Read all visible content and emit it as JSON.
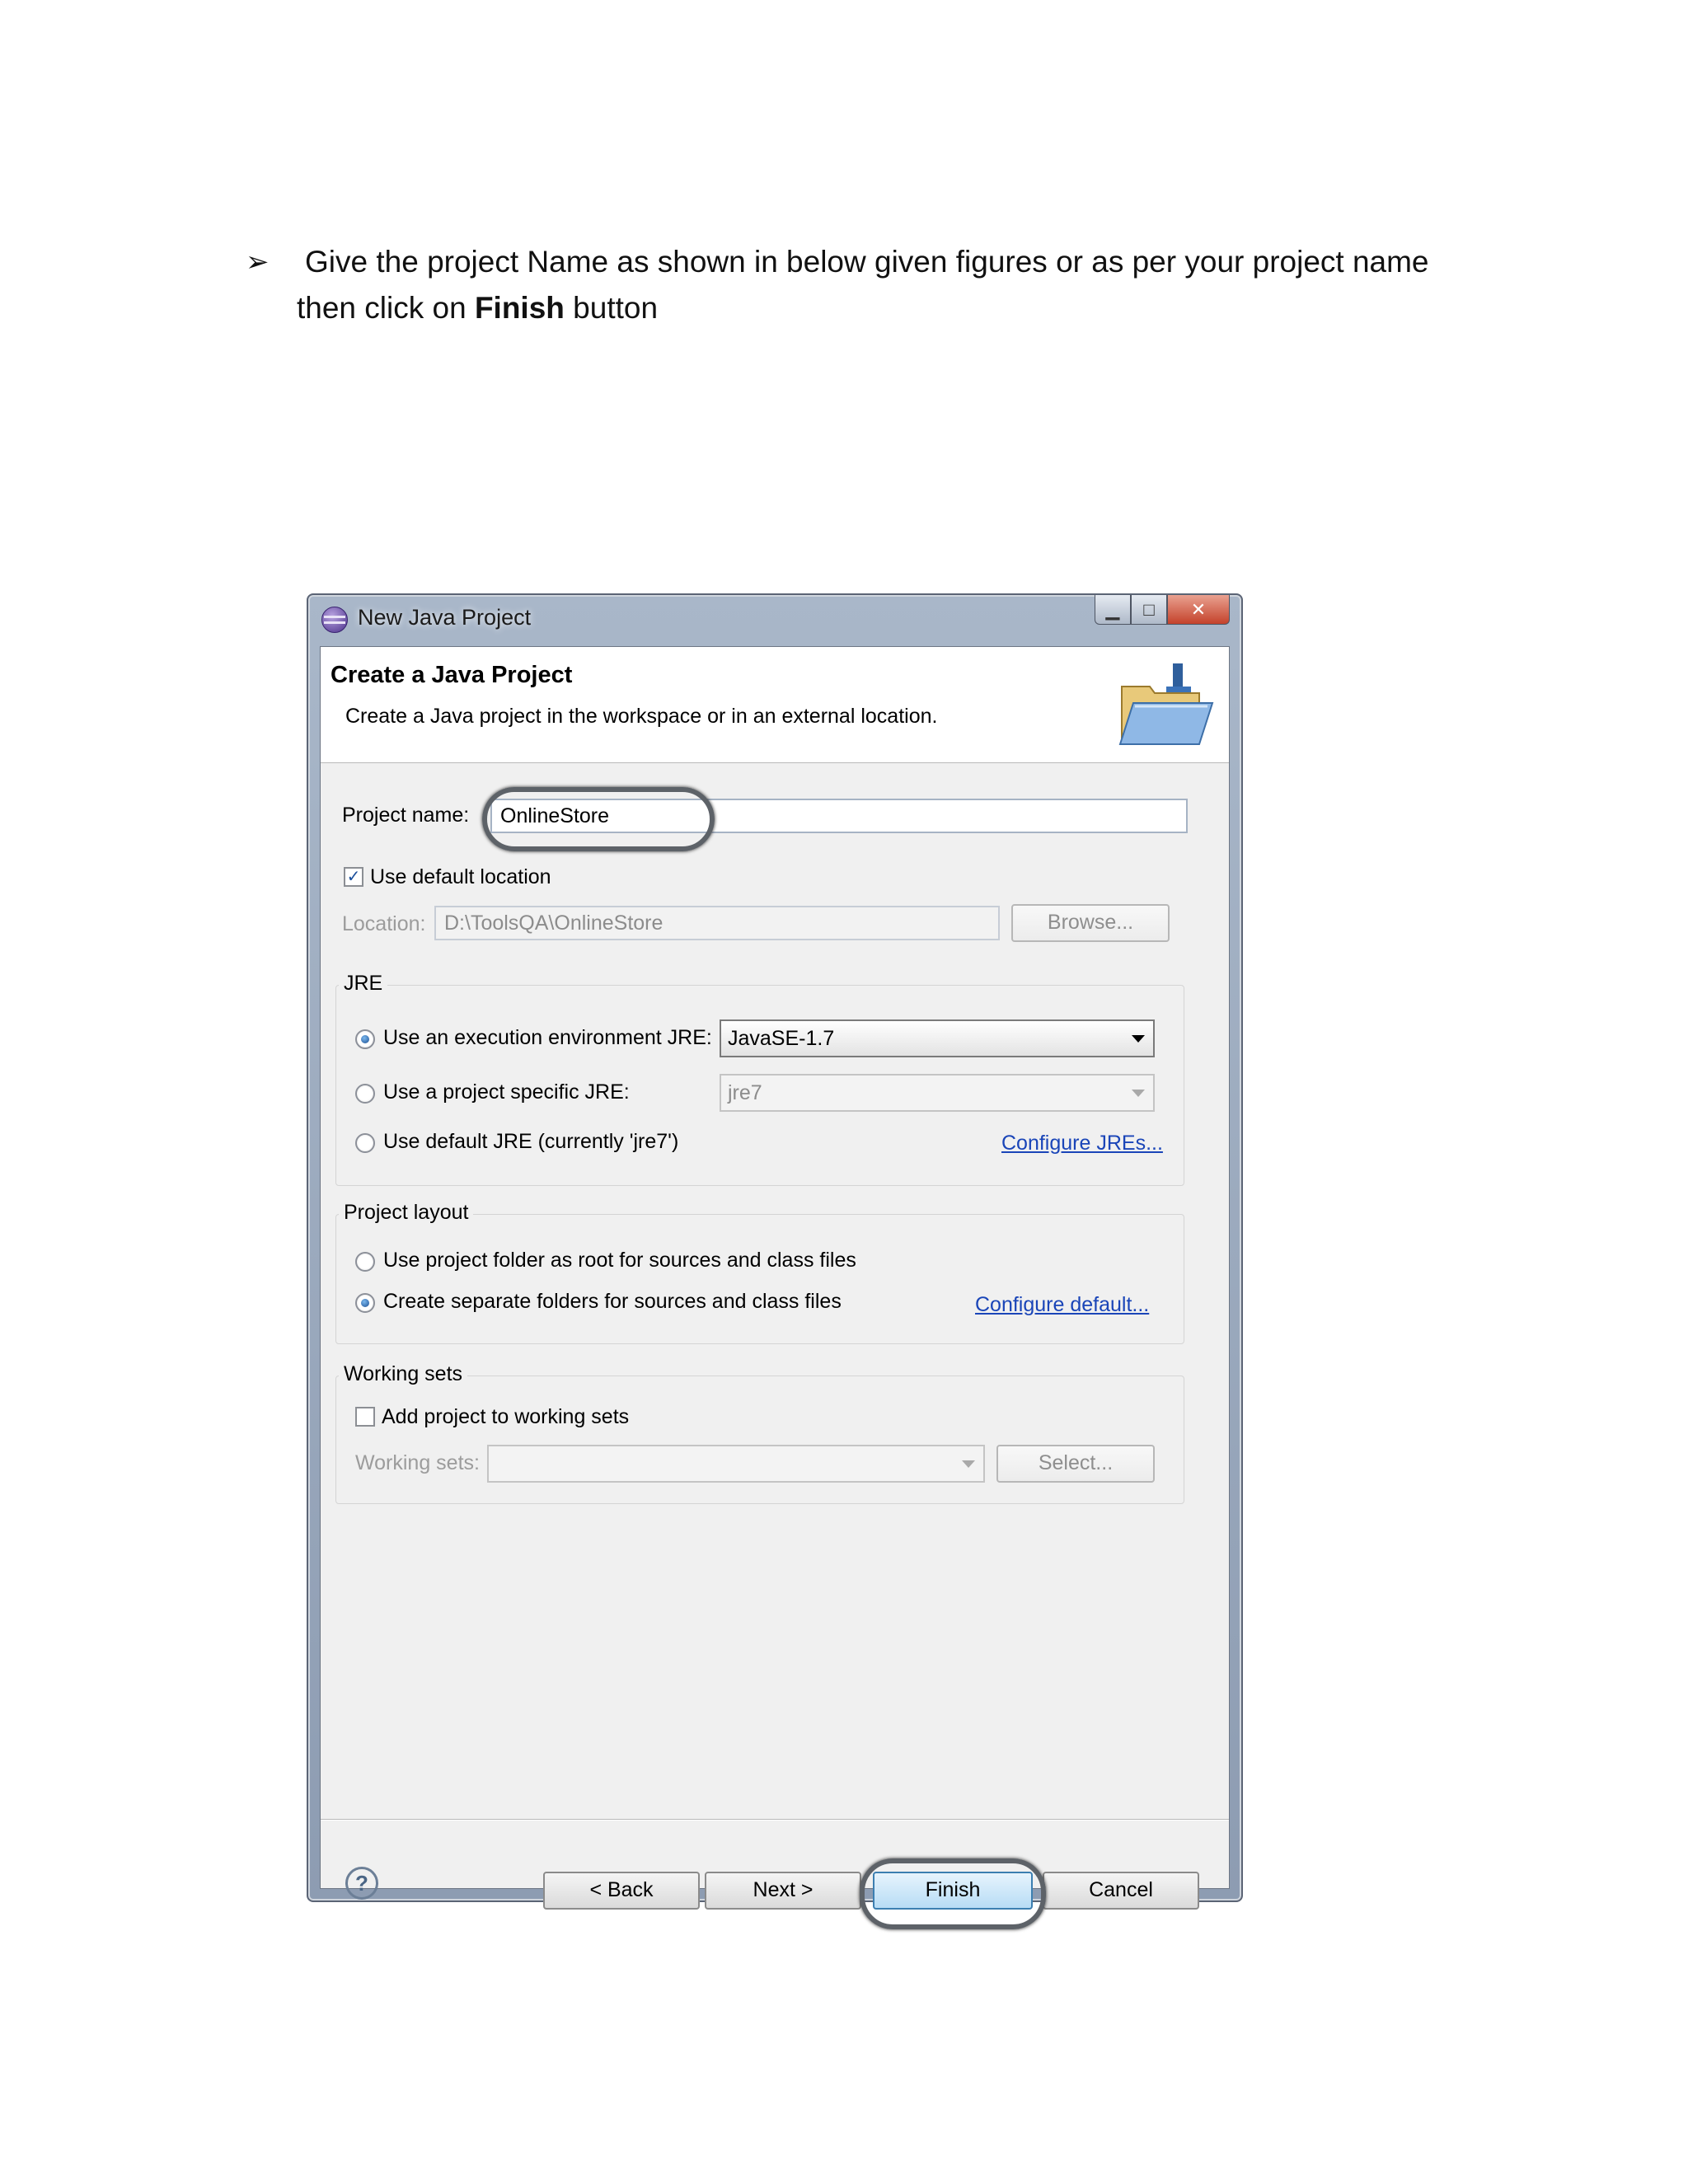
{
  "document": {
    "bullet": "➢",
    "line1": "Give the project Name as shown in below given figures or as per your project name",
    "line2_prefix": "then click on ",
    "line2_bold": "Finish",
    "line2_suffix": " button"
  },
  "dialog": {
    "window_title": "New Java Project",
    "header_title": "Create a Java Project",
    "header_description": "Create a Java project in the workspace or in an external location.",
    "project_name_label": "Project name:",
    "project_name_value": "OnlineStore",
    "use_default_location_label": "Use default location",
    "use_default_location_checked": true,
    "location_label": "Location:",
    "location_value": "D:\\ToolsQA\\OnlineStore",
    "browse_label": "Browse...",
    "jre": {
      "group_title": "JRE",
      "option_execution_env": "Use an execution environment JRE:",
      "execution_env_value": "JavaSE-1.7",
      "option_project_specific": "Use a project specific JRE:",
      "project_specific_value": "jre7",
      "option_default": "Use default JRE (currently 'jre7')",
      "configure_link": "Configure JREs...",
      "selected": "execution_env"
    },
    "project_layout": {
      "group_title": "Project layout",
      "option_root": "Use project folder as root for sources and class files",
      "option_separate": "Create separate folders for sources and class files",
      "configure_link": "Configure default...",
      "selected": "separate"
    },
    "working_sets": {
      "group_title": "Working sets",
      "add_label": "Add project to working sets",
      "add_checked": false,
      "working_sets_label": "Working sets:",
      "working_sets_value": "",
      "select_label": "Select..."
    },
    "buttons": {
      "help": "?",
      "back": "< Back",
      "next": "Next >",
      "finish": "Finish",
      "cancel": "Cancel"
    },
    "colors": {
      "link": "#1a45b8",
      "highlight": "#5d6268",
      "title_bar": "#a9b7c9"
    }
  }
}
